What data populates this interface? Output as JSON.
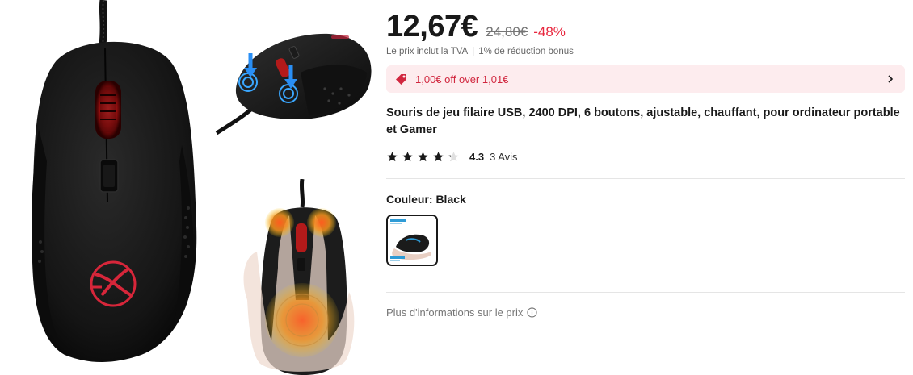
{
  "gallery": {
    "main_image_alt": "mouse-main-photo",
    "thumbnails": [
      "mouse-side-buttons-photo",
      "mouse-heated-hand-photo"
    ]
  },
  "price": {
    "current": "12,67€",
    "original": "24,80€",
    "discount": "-48%"
  },
  "tax": {
    "included": "Le prix inclut la TVA",
    "separator": "|",
    "bonus": "1% de réduction bonus"
  },
  "coupon": {
    "text": "1,00€ off over 1,01€",
    "icon": "tag-icon"
  },
  "product": {
    "title": "Souris de jeu filaire USB, 2400 DPI, 6 boutons, ajustable, chauffant, pour ordinateur portable et Gamer"
  },
  "rating": {
    "value": "4.3",
    "stars_value": 4.3,
    "stars_max": 5,
    "count_label": "3 Avis"
  },
  "color": {
    "label": "Couleur: Black",
    "selected": "Black"
  },
  "more_info": {
    "text": "Plus d'informations sur le prix",
    "icon": "info-icon"
  },
  "colors": {
    "accent_red": "#e8283f",
    "coupon_bg": "#fdecee",
    "text_dark": "#191919",
    "text_muted": "#757575"
  }
}
